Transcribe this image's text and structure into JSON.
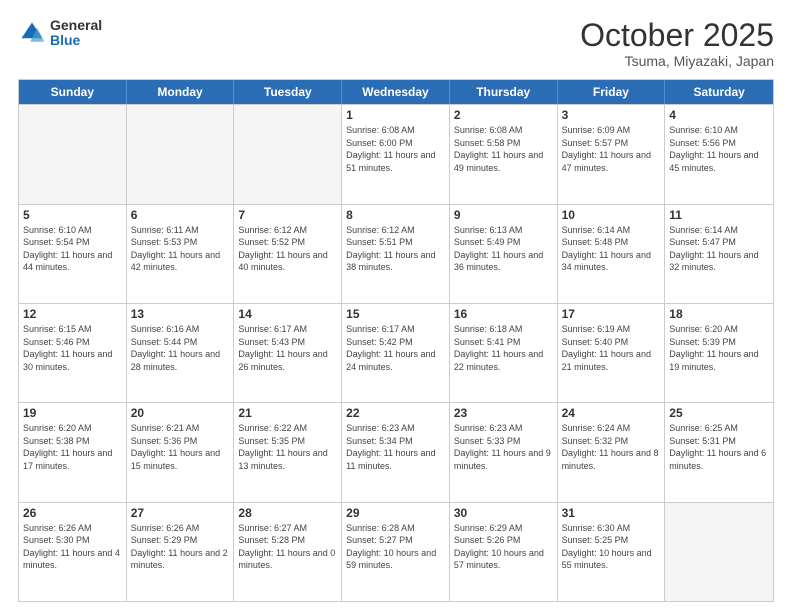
{
  "header": {
    "logo_general": "General",
    "logo_blue": "Blue",
    "month_title": "October 2025",
    "location": "Tsuma, Miyazaki, Japan"
  },
  "calendar": {
    "days": [
      "Sunday",
      "Monday",
      "Tuesday",
      "Wednesday",
      "Thursday",
      "Friday",
      "Saturday"
    ],
    "rows": [
      [
        {
          "date": "",
          "empty": true
        },
        {
          "date": "",
          "empty": true
        },
        {
          "date": "",
          "empty": true
        },
        {
          "date": "1",
          "sunrise": "Sunrise: 6:08 AM",
          "sunset": "Sunset: 6:00 PM",
          "daylight": "Daylight: 11 hours and 51 minutes."
        },
        {
          "date": "2",
          "sunrise": "Sunrise: 6:08 AM",
          "sunset": "Sunset: 5:58 PM",
          "daylight": "Daylight: 11 hours and 49 minutes."
        },
        {
          "date": "3",
          "sunrise": "Sunrise: 6:09 AM",
          "sunset": "Sunset: 5:57 PM",
          "daylight": "Daylight: 11 hours and 47 minutes."
        },
        {
          "date": "4",
          "sunrise": "Sunrise: 6:10 AM",
          "sunset": "Sunset: 5:56 PM",
          "daylight": "Daylight: 11 hours and 45 minutes."
        }
      ],
      [
        {
          "date": "5",
          "sunrise": "Sunrise: 6:10 AM",
          "sunset": "Sunset: 5:54 PM",
          "daylight": "Daylight: 11 hours and 44 minutes."
        },
        {
          "date": "6",
          "sunrise": "Sunrise: 6:11 AM",
          "sunset": "Sunset: 5:53 PM",
          "daylight": "Daylight: 11 hours and 42 minutes."
        },
        {
          "date": "7",
          "sunrise": "Sunrise: 6:12 AM",
          "sunset": "Sunset: 5:52 PM",
          "daylight": "Daylight: 11 hours and 40 minutes."
        },
        {
          "date": "8",
          "sunrise": "Sunrise: 6:12 AM",
          "sunset": "Sunset: 5:51 PM",
          "daylight": "Daylight: 11 hours and 38 minutes."
        },
        {
          "date": "9",
          "sunrise": "Sunrise: 6:13 AM",
          "sunset": "Sunset: 5:49 PM",
          "daylight": "Daylight: 11 hours and 36 minutes."
        },
        {
          "date": "10",
          "sunrise": "Sunrise: 6:14 AM",
          "sunset": "Sunset: 5:48 PM",
          "daylight": "Daylight: 11 hours and 34 minutes."
        },
        {
          "date": "11",
          "sunrise": "Sunrise: 6:14 AM",
          "sunset": "Sunset: 5:47 PM",
          "daylight": "Daylight: 11 hours and 32 minutes."
        }
      ],
      [
        {
          "date": "12",
          "sunrise": "Sunrise: 6:15 AM",
          "sunset": "Sunset: 5:46 PM",
          "daylight": "Daylight: 11 hours and 30 minutes."
        },
        {
          "date": "13",
          "sunrise": "Sunrise: 6:16 AM",
          "sunset": "Sunset: 5:44 PM",
          "daylight": "Daylight: 11 hours and 28 minutes."
        },
        {
          "date": "14",
          "sunrise": "Sunrise: 6:17 AM",
          "sunset": "Sunset: 5:43 PM",
          "daylight": "Daylight: 11 hours and 26 minutes."
        },
        {
          "date": "15",
          "sunrise": "Sunrise: 6:17 AM",
          "sunset": "Sunset: 5:42 PM",
          "daylight": "Daylight: 11 hours and 24 minutes."
        },
        {
          "date": "16",
          "sunrise": "Sunrise: 6:18 AM",
          "sunset": "Sunset: 5:41 PM",
          "daylight": "Daylight: 11 hours and 22 minutes."
        },
        {
          "date": "17",
          "sunrise": "Sunrise: 6:19 AM",
          "sunset": "Sunset: 5:40 PM",
          "daylight": "Daylight: 11 hours and 21 minutes."
        },
        {
          "date": "18",
          "sunrise": "Sunrise: 6:20 AM",
          "sunset": "Sunset: 5:39 PM",
          "daylight": "Daylight: 11 hours and 19 minutes."
        }
      ],
      [
        {
          "date": "19",
          "sunrise": "Sunrise: 6:20 AM",
          "sunset": "Sunset: 5:38 PM",
          "daylight": "Daylight: 11 hours and 17 minutes."
        },
        {
          "date": "20",
          "sunrise": "Sunrise: 6:21 AM",
          "sunset": "Sunset: 5:36 PM",
          "daylight": "Daylight: 11 hours and 15 minutes."
        },
        {
          "date": "21",
          "sunrise": "Sunrise: 6:22 AM",
          "sunset": "Sunset: 5:35 PM",
          "daylight": "Daylight: 11 hours and 13 minutes."
        },
        {
          "date": "22",
          "sunrise": "Sunrise: 6:23 AM",
          "sunset": "Sunset: 5:34 PM",
          "daylight": "Daylight: 11 hours and 11 minutes."
        },
        {
          "date": "23",
          "sunrise": "Sunrise: 6:23 AM",
          "sunset": "Sunset: 5:33 PM",
          "daylight": "Daylight: 11 hours and 9 minutes."
        },
        {
          "date": "24",
          "sunrise": "Sunrise: 6:24 AM",
          "sunset": "Sunset: 5:32 PM",
          "daylight": "Daylight: 11 hours and 8 minutes."
        },
        {
          "date": "25",
          "sunrise": "Sunrise: 6:25 AM",
          "sunset": "Sunset: 5:31 PM",
          "daylight": "Daylight: 11 hours and 6 minutes."
        }
      ],
      [
        {
          "date": "26",
          "sunrise": "Sunrise: 6:26 AM",
          "sunset": "Sunset: 5:30 PM",
          "daylight": "Daylight: 11 hours and 4 minutes."
        },
        {
          "date": "27",
          "sunrise": "Sunrise: 6:26 AM",
          "sunset": "Sunset: 5:29 PM",
          "daylight": "Daylight: 11 hours and 2 minutes."
        },
        {
          "date": "28",
          "sunrise": "Sunrise: 6:27 AM",
          "sunset": "Sunset: 5:28 PM",
          "daylight": "Daylight: 11 hours and 0 minutes."
        },
        {
          "date": "29",
          "sunrise": "Sunrise: 6:28 AM",
          "sunset": "Sunset: 5:27 PM",
          "daylight": "Daylight: 10 hours and 59 minutes."
        },
        {
          "date": "30",
          "sunrise": "Sunrise: 6:29 AM",
          "sunset": "Sunset: 5:26 PM",
          "daylight": "Daylight: 10 hours and 57 minutes."
        },
        {
          "date": "31",
          "sunrise": "Sunrise: 6:30 AM",
          "sunset": "Sunset: 5:25 PM",
          "daylight": "Daylight: 10 hours and 55 minutes."
        },
        {
          "date": "",
          "empty": true
        }
      ]
    ]
  }
}
